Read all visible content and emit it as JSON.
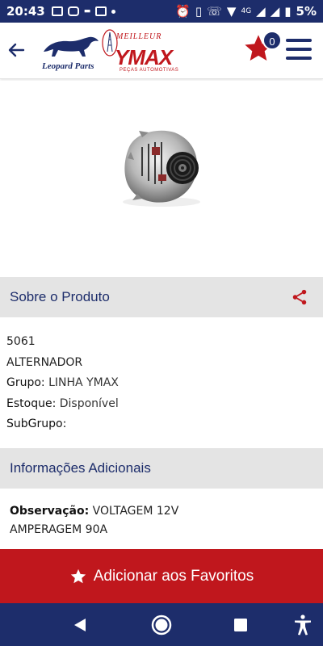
{
  "status_bar": {
    "time": "20:43",
    "network": "4G",
    "battery": "5%"
  },
  "header": {
    "brand_left": "Leopard Parts",
    "brand_right_top": "MEILLEUR",
    "brand_right_main": "YMAX",
    "brand_right_sub": "PEÇAS AUTOMOTIVAS",
    "favorites_count": "0"
  },
  "product": {
    "image_icon": "alternator-image"
  },
  "about": {
    "title": "Sobre o Produto",
    "code": "5061",
    "name": "ALTERNADOR",
    "group_label": "Grupo:",
    "group_value": "LINHA YMAX",
    "stock_label": "Estoque:",
    "stock_value": "Disponível",
    "subgroup_label": "SubGrupo:",
    "subgroup_value": ""
  },
  "additional": {
    "title": "Informações Adicionais",
    "obs_label": "Observação:",
    "obs_line1": "VOLTAGEM 12V",
    "obs_line2": "AMPERAGEM 90A"
  },
  "actions": {
    "add_favorites_label": "Adicionar aos Favoritos"
  },
  "colors": {
    "brand_navy": "#1d2d6b",
    "brand_red": "#c0171d",
    "section_bg": "#e4e4e4"
  }
}
